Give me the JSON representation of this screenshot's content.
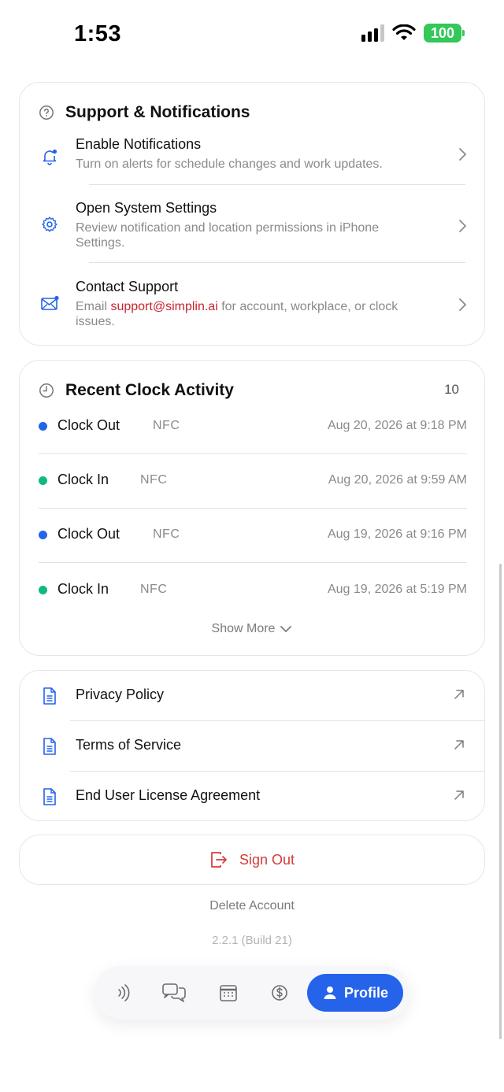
{
  "status_bar": {
    "time": "1:53",
    "battery": "100"
  },
  "support": {
    "title": "Support & Notifications",
    "items": [
      {
        "title": "Enable Notifications",
        "desc": "Turn on alerts for schedule changes and work updates.",
        "icon": "bell-icon"
      },
      {
        "title": "Open System Settings",
        "desc": "Review notification and location permissions in iPhone Settings.",
        "icon": "gear-icon"
      },
      {
        "title": "Contact Support",
        "desc_prefix": "Email ",
        "email": "support@simplin.ai",
        "desc_suffix": " for account, workplace, or clock issues.",
        "icon": "mail-icon"
      }
    ]
  },
  "activity": {
    "title": "Recent Clock Activity",
    "count": "10",
    "rows": [
      {
        "action": "Clock Out",
        "method": "NFC",
        "when": "Aug 20, 2026 at 9:18 PM",
        "color": "#2563eb"
      },
      {
        "action": "Clock In",
        "method": "NFC",
        "when": "Aug 20, 2026 at 9:59 AM",
        "color": "#10b981"
      },
      {
        "action": "Clock Out",
        "method": "NFC",
        "when": "Aug 19, 2026 at 9:16 PM",
        "color": "#2563eb"
      },
      {
        "action": "Clock In",
        "method": "NFC",
        "when": "Aug 19, 2026 at 5:19 PM",
        "color": "#10b981"
      }
    ],
    "show_more": "Show More"
  },
  "legal": {
    "items": [
      {
        "label": "Privacy Policy"
      },
      {
        "label": "Terms of Service"
      },
      {
        "label": "End User License Agreement"
      }
    ]
  },
  "sign_out": "Sign Out",
  "delete_account": "Delete Account",
  "version": "2.2.1 (Build 21)",
  "tabbar": {
    "items": [
      "nfc-icon",
      "chat-icon",
      "calendar-icon",
      "dollar-icon"
    ],
    "active_label": "Profile"
  },
  "colors": {
    "accent": "#2563eb",
    "danger": "#d63a3a",
    "clock_in": "#10b981",
    "clock_out": "#2563eb",
    "link": "#c4262e"
  }
}
